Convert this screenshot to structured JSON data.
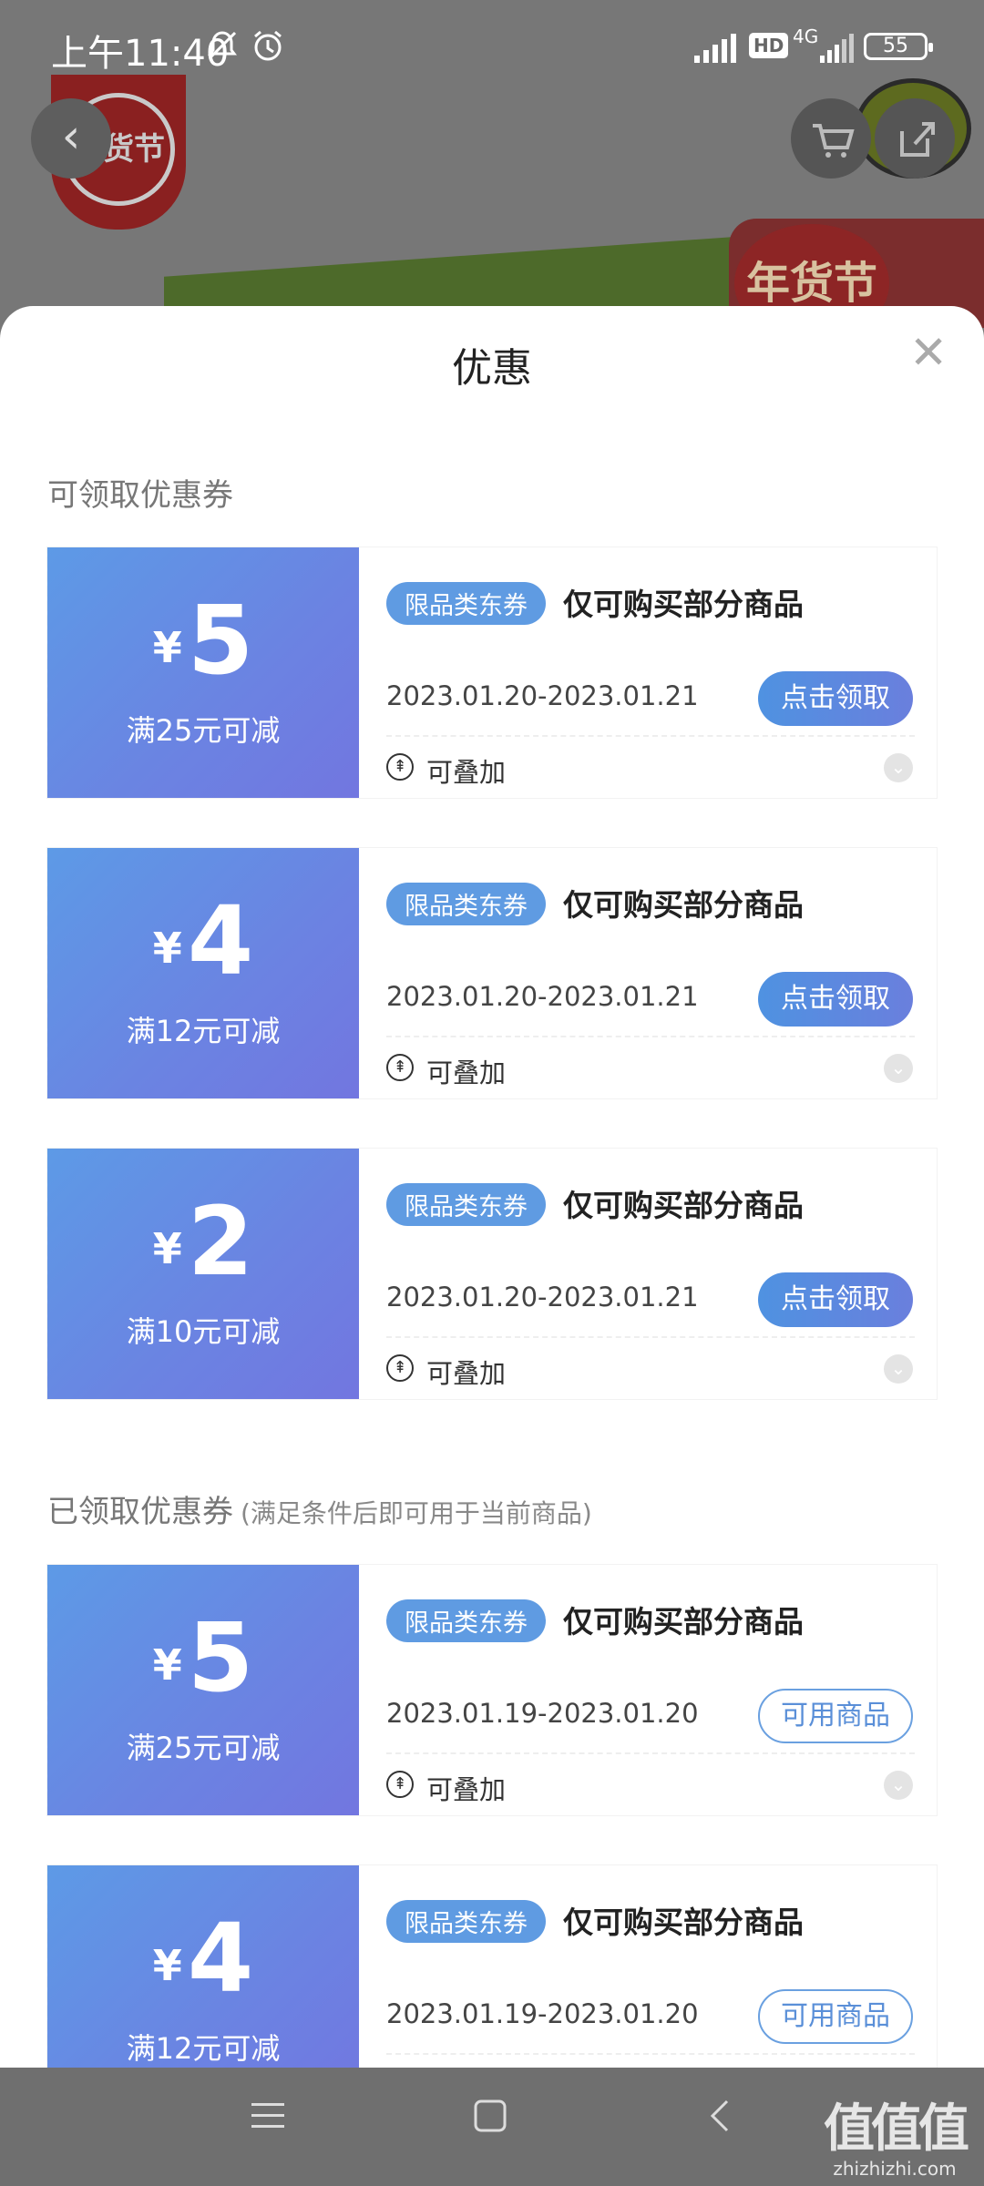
{
  "status_bar": {
    "time": "上午11:40",
    "network": "4G",
    "hd": "HD",
    "battery": "55"
  },
  "background": {
    "badge_text": "年货节",
    "banner_text": "年货节"
  },
  "sheet": {
    "title": "优惠",
    "close_icon": "close-icon"
  },
  "available_section": {
    "title": "可领取优惠券"
  },
  "claimed_section": {
    "title": "已领取优惠券",
    "hint": "(满足条件后即可用于当前商品)"
  },
  "available_coupons": [
    {
      "currency": "¥",
      "amount": "5",
      "threshold": "满25元可减",
      "tag": "限品类东券",
      "desc": "仅可购买部分商品",
      "date": "2023.01.20-2023.01.21",
      "button": "点击领取",
      "stack": "可叠加"
    },
    {
      "currency": "¥",
      "amount": "4",
      "threshold": "满12元可减",
      "tag": "限品类东券",
      "desc": "仅可购买部分商品",
      "date": "2023.01.20-2023.01.21",
      "button": "点击领取",
      "stack": "可叠加"
    },
    {
      "currency": "¥",
      "amount": "2",
      "threshold": "满10元可减",
      "tag": "限品类东券",
      "desc": "仅可购买部分商品",
      "date": "2023.01.20-2023.01.21",
      "button": "点击领取",
      "stack": "可叠加"
    }
  ],
  "claimed_coupons": [
    {
      "currency": "¥",
      "amount": "5",
      "threshold": "满25元可减",
      "tag": "限品类东券",
      "desc": "仅可购买部分商品",
      "date": "2023.01.19-2023.01.20",
      "button": "可用商品",
      "stack": "可叠加"
    },
    {
      "currency": "¥",
      "amount": "4",
      "threshold": "满12元可减",
      "tag": "限品类东券",
      "desc": "仅可购买部分商品",
      "date": "2023.01.19-2023.01.20",
      "button": "可用商品"
    }
  ],
  "nav": {
    "menu_icon": "menu-icon",
    "home_icon": "home-icon",
    "back_icon": "back-icon"
  },
  "watermark": {
    "logo": "值值值",
    "url": "zhizhizhi.com"
  },
  "colors": {
    "coupon_gradient_start": "#5d9ae6",
    "coupon_gradient_end": "#7276e0",
    "tag_blue": "#5f9be2",
    "overlay_gray": "#6f6f6f"
  }
}
